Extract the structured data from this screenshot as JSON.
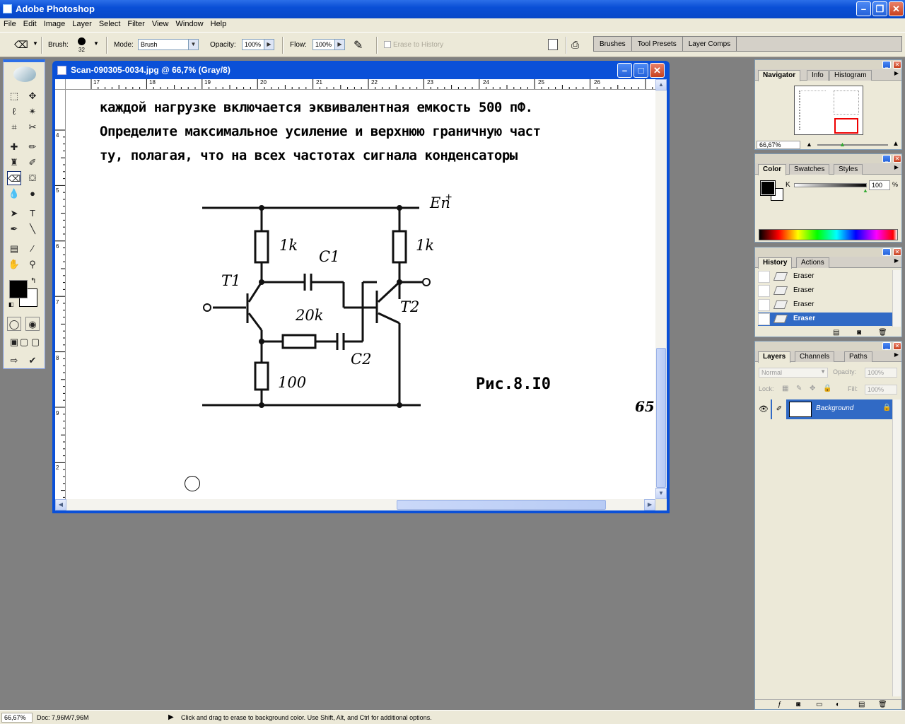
{
  "app": {
    "title": "Adobe Photoshop"
  },
  "menu": [
    "File",
    "Edit",
    "Image",
    "Layer",
    "Select",
    "Filter",
    "View",
    "Window",
    "Help"
  ],
  "options": {
    "brush_label": "Brush:",
    "brush_size": "32",
    "mode_label": "Mode:",
    "mode_value": "Brush",
    "opacity_label": "Opacity:",
    "opacity_value": "100%",
    "flow_label": "Flow:",
    "flow_value": "100%",
    "erase_history_label": "Erase to History",
    "well_tabs": [
      "Brushes",
      "Tool Presets",
      "Layer Comps"
    ]
  },
  "document": {
    "title": "Scan-090305-0034.jpg @ 66,7% (Gray/8)",
    "ruler_top": [
      "17",
      "18",
      "19",
      "20",
      "21",
      "22",
      "23",
      "24",
      "25",
      "26"
    ],
    "ruler_left": [
      "4",
      "5",
      "6",
      "7",
      "8",
      "9",
      "2"
    ],
    "text_line1": "каждой нагрузке включается эквивалентная  емкость 500 пФ.",
    "text_line2": "Определите максимальное усиление и верхнюю граничную част",
    "text_line3": "ту, полагая, что на всех частотах сигнала конденсаторы",
    "circuit": {
      "supply": "Eп",
      "supply_sign": "+",
      "r1": "1k",
      "r2": "1k",
      "c1": "C1",
      "c2": "C2",
      "r3": "20k",
      "r4": "100",
      "t1": "T1",
      "t2": "T2"
    },
    "fig_caption": "Рис.8.I0",
    "page_number": "65"
  },
  "navigator": {
    "tabs": [
      "Navigator",
      "Info",
      "Histogram"
    ],
    "zoom": "66,67%"
  },
  "color": {
    "tabs": [
      "Color",
      "Swatches",
      "Styles"
    ],
    "channel": "K",
    "value": "100",
    "unit": "%"
  },
  "history": {
    "tabs": [
      "History",
      "Actions"
    ],
    "items": [
      "Eraser",
      "Eraser",
      "Eraser",
      "Eraser"
    ]
  },
  "layers": {
    "tabs": [
      "Layers",
      "Channels",
      "Paths"
    ],
    "blend": "Normal",
    "opacity_label": "Opacity:",
    "opacity": "100%",
    "lock_label": "Lock:",
    "fill_label": "Fill:",
    "fill": "100%",
    "layer_name": "Background"
  },
  "status": {
    "zoom": "66,67%",
    "doc": "Doc: 7,96M/7,96M",
    "hint": "Click and drag to erase to background color.  Use Shift, Alt, and Ctrl for additional options."
  },
  "colors": {
    "xp_blue": "#0a50d8",
    "selection": "#316ac5",
    "workspace": "#808080"
  }
}
